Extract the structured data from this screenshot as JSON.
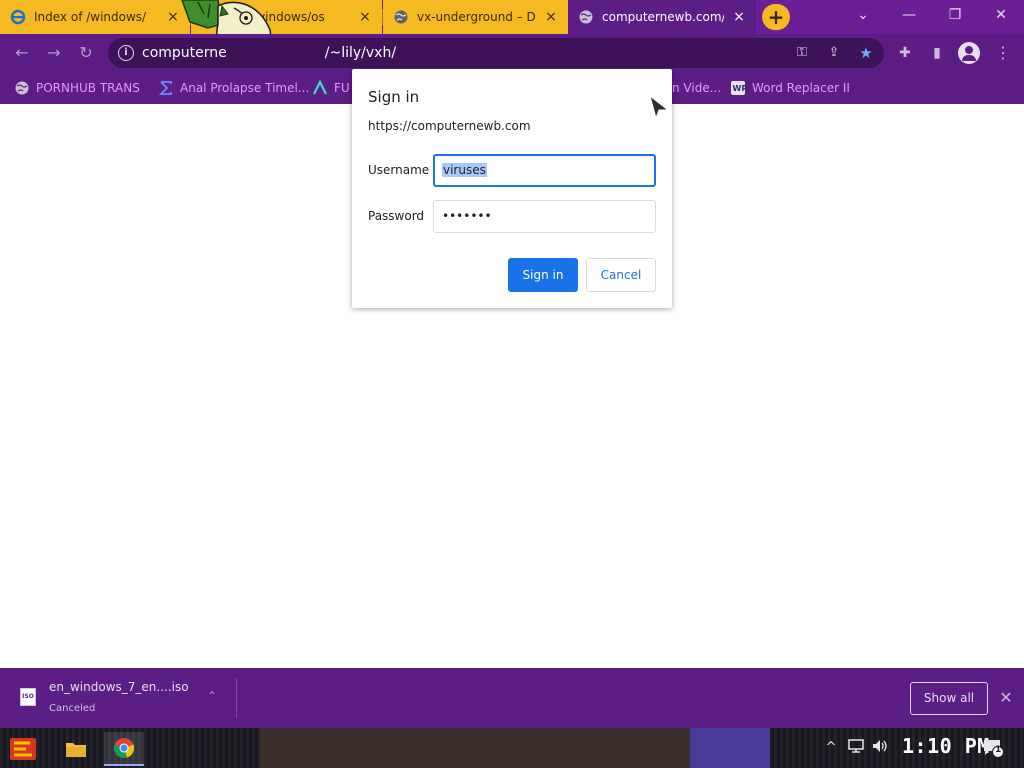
{
  "tabs": [
    {
      "title": "Index of /windows/",
      "close": "×",
      "favicon": "ie-icon"
    },
    {
      "title": "x of /windows/os",
      "close": "×",
      "favicon": "ie-icon"
    },
    {
      "title": "vx-underground – Dire",
      "close": "×",
      "favicon": "globe-icon"
    },
    {
      "title": "computernewb.com/~li",
      "close": "×",
      "favicon": "globe-icon"
    }
  ],
  "new_tab_label": "+",
  "window_controls": {
    "dropdown": "⌄",
    "minimize": "—",
    "restore": "❐",
    "close": "✕"
  },
  "toolbar": {
    "back": "←",
    "forward": "→",
    "reload": "↻",
    "url_host": "computerne",
    "url_path": "/~lily/vxh/",
    "key_icon": "⚿",
    "share_icon": "⇪",
    "star_icon": "★",
    "extensions_icon": "✚",
    "sidepanel_icon": "▮",
    "menu_icon": "⋮"
  },
  "bookmarks": [
    {
      "label": "PORNHUB TRANS",
      "icon": "globe-icon"
    },
    {
      "label": "Anal Prolapse Timel...",
      "icon": "sigma-icon"
    },
    {
      "label": "FU",
      "icon": "lambda-icon"
    },
    {
      "label": "n Vide...",
      "icon": "globe-icon"
    },
    {
      "label": "Word Replacer II",
      "icon": "wr-icon"
    }
  ],
  "dialog": {
    "title": "Sign in",
    "origin": "https://computernewb.com",
    "username_label": "Username",
    "username_value": "viruses",
    "password_label": "Password",
    "password_value": "•••••••",
    "sign_in": "Sign in",
    "cancel": "Cancel"
  },
  "download_shelf": {
    "file_name": "en_windows_7_en....iso",
    "status": "Canceled",
    "icon_text": "ISO",
    "show_all": "Show all",
    "close": "✕"
  },
  "taskbar": {
    "clock": "1:10 PM",
    "tray_arrow": "^",
    "notification_count": "1"
  },
  "colors": {
    "theme_purple": "#5c1d84",
    "tab_yellow": "#f5b921",
    "bookmark_text": "#e896ff",
    "accent_blue": "#1a73e8"
  }
}
